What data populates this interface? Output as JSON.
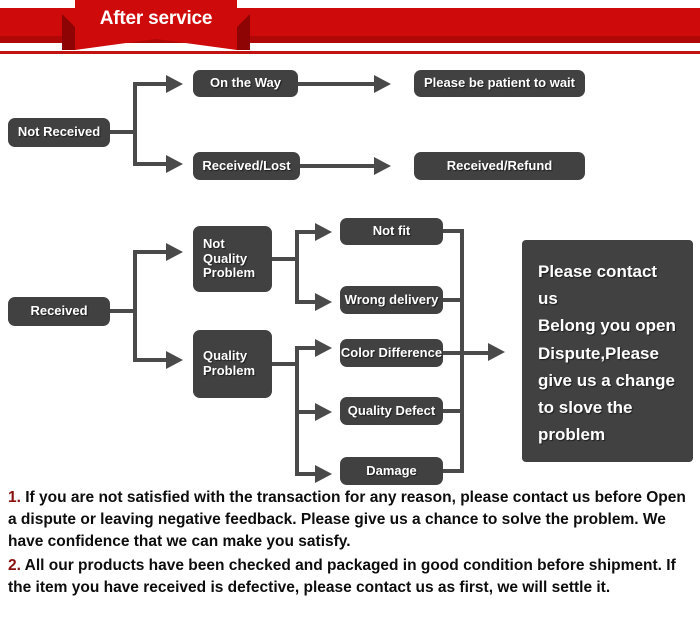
{
  "banner": {
    "title": "After service",
    "bar_color": "#cf0a0a",
    "fold_color": "#8e0404",
    "rule_color": "#c21313"
  },
  "theme": {
    "node_fill": "#414141",
    "connector": "#4a4a4a",
    "text": "#ffffff",
    "note_number_color": "#8a1010"
  },
  "flow_not_received": {
    "root": "Not Received",
    "branches": [
      {
        "state": "On the Way",
        "outcome": "Please be patient to wait"
      },
      {
        "state": "Received/Lost",
        "outcome": "Received/Refund"
      }
    ]
  },
  "flow_received": {
    "root": "Received",
    "categories": [
      {
        "label": "Not Quality\nProblem",
        "line1": "Not",
        "line2": "Quality",
        "line3": "Problem",
        "reasons": [
          "Not fit",
          "Wrong delivery"
        ]
      },
      {
        "label": "Quality Problem",
        "line1": "Quality",
        "line2": "Problem",
        "reasons": [
          "Color Difference",
          "Quality Defect",
          "Damage"
        ]
      }
    ],
    "outcome": {
      "lines": [
        "Please contact us",
        "Belong you open",
        "Dispute,Please",
        "give us a change",
        "to slove the",
        "problem"
      ]
    }
  },
  "notes": [
    {
      "number": "1.",
      "text": " If you are not satisfied with the transaction for any reason, please contact us before Open a dispute or leaving negative feedback. Please give us a chance to solve the problem. We have confidence that we can make you satisfy."
    },
    {
      "number": "2.",
      "text": " All our products have been checked and packaged in good condition before shipment. If the item you have received is defective, please contact us as first, we will settle it."
    }
  ]
}
